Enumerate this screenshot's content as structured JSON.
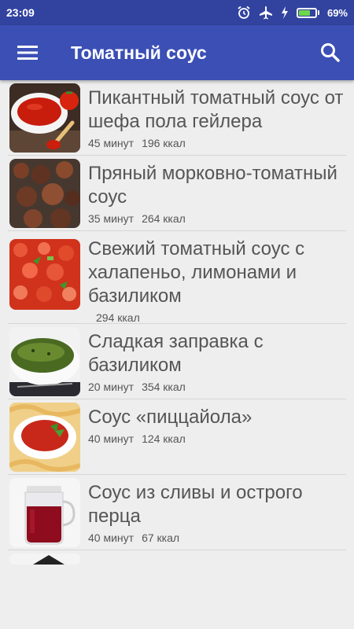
{
  "status": {
    "time": "23:09",
    "battery": "69%",
    "battery_level": 0.69
  },
  "appbar": {
    "title": "Томатный соус",
    "menu_icon": "menu-icon",
    "search_icon": "search-icon"
  },
  "recipes": [
    {
      "title": "Пикантный томатный соус от шефа пола гейлера",
      "time": "45 минут",
      "kcal": "196 ккал"
    },
    {
      "title": "Пряный морковно-томатный соус",
      "time": "35 минут",
      "kcal": "264 ккал"
    },
    {
      "title": "Свежий томатный соус с халапеньо, лимонами и базиликом",
      "time": "",
      "kcal": "294 ккал"
    },
    {
      "title": "Сладкая заправка с базиликом",
      "time": "20 минут",
      "kcal": "354 ккал"
    },
    {
      "title": "Соус «пиццайола»",
      "time": "40 минут",
      "kcal": "124 ккал"
    },
    {
      "title": "Соус из сливы и острого перца",
      "time": "40 минут",
      "kcal": "67 ккал"
    }
  ]
}
